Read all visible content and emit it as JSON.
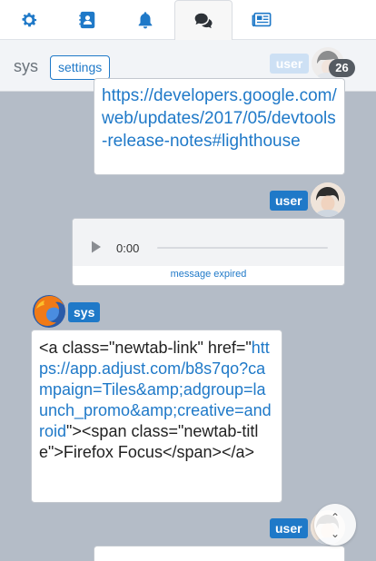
{
  "tabs": [
    {
      "name": "settings-gear",
      "icon": "gear-icon",
      "active": false
    },
    {
      "name": "contacts",
      "icon": "address-book-icon",
      "active": false
    },
    {
      "name": "notifications",
      "icon": "bell-icon",
      "active": false
    },
    {
      "name": "chat",
      "icon": "chat-bubbles-icon",
      "active": true
    },
    {
      "name": "news",
      "icon": "newspaper-icon",
      "active": false
    }
  ],
  "header": {
    "channel": "sys",
    "settings_label": "settings",
    "user_label": "user",
    "unread_count": "26"
  },
  "messages": {
    "link": {
      "text": "https://developers.google.com/web/updates/2017/05/devtools-release-notes#lighthouse"
    },
    "audio": {
      "sender": "user",
      "time": "0:00",
      "status": "message expired"
    },
    "code": {
      "sender": "sys",
      "before": "<a class=\"newtab-link\" href=\"",
      "link": "https://app.adjust.com/b8s7qo?campaign=Tiles&amp;adgroup=launch_promo&amp;creative=android",
      "after": "\"><span class=\"newtab-title\">Firefox Focus</span></a>"
    },
    "last": {
      "sender": "user"
    }
  },
  "colors": {
    "accent": "#1f79c8",
    "background": "#b4bcc7"
  }
}
